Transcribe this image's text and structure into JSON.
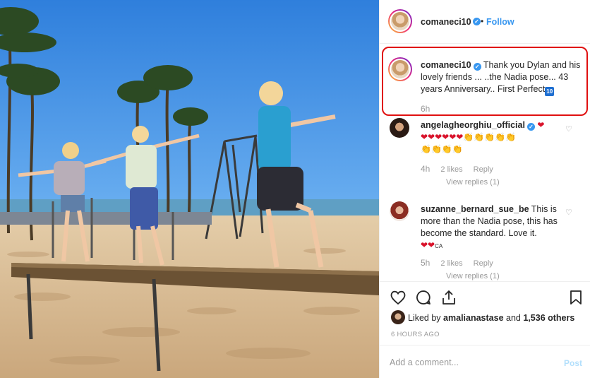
{
  "post": {
    "author": "comaneci10",
    "follow_label": "Follow",
    "header_separator": "•",
    "verified_glyph": "✓"
  },
  "caption": {
    "username": "comaneci10",
    "text": "Thank you Dylan and his lovely friends ... ..the Nadia pose... 43 years Anniversary.. First Perfect",
    "badge": "10",
    "time": "6h"
  },
  "comments": [
    {
      "username": "angelagheorghiu_official",
      "verified": true,
      "emoji_line1": "❤",
      "emoji_line2": "❤❤❤❤❤❤",
      "emoji_line2b": "👏👏👏👏👏",
      "emoji_line3": "👏👏👏👏",
      "time": "4h",
      "likes": "2 likes",
      "reply_label": "Reply",
      "view_replies": "View replies (1)"
    },
    {
      "username": "suzanne_bernard_sue_be",
      "text": "This is more than the Nadia pose, this has become the standard. Love it.",
      "emoji": "❤❤",
      "emoji_suffix": "CA",
      "time": "5h",
      "likes": "2 likes",
      "reply_label": "Reply",
      "view_replies": "View replies (1)"
    }
  ],
  "actions": {
    "liked_by_prefix": "Liked by",
    "liked_by_user": "amalianastase",
    "liked_by_conj": "and",
    "others": "1,536 others",
    "time_ago": "6 HOURS AGO"
  },
  "add_comment": {
    "placeholder": "Add a comment...",
    "post_label": "Post"
  },
  "colors": {
    "accent": "#3897f0",
    "highlight": "#e01010",
    "muted": "#999999"
  }
}
